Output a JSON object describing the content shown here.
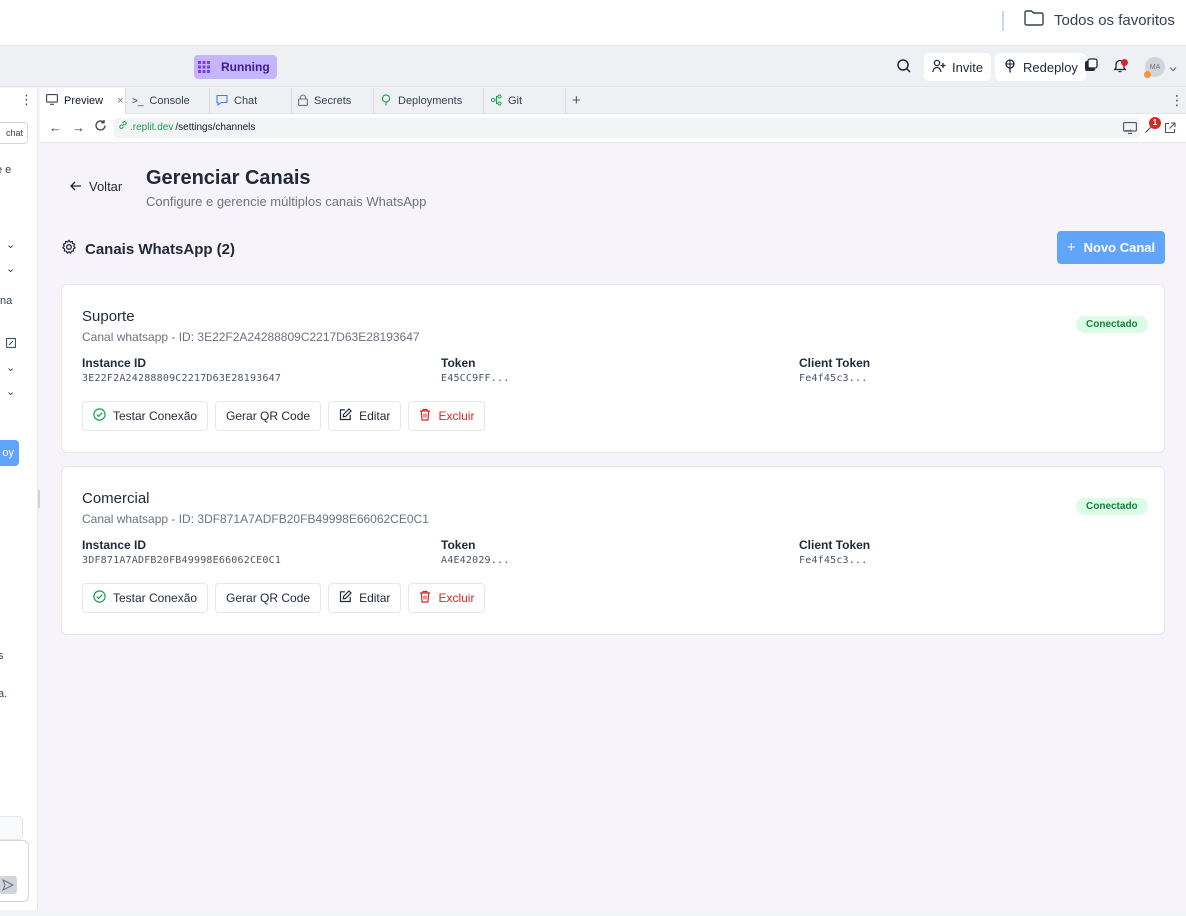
{
  "bookmarks": {
    "folder_label": "Todos os favoritos"
  },
  "topbar": {
    "status": "Running",
    "invite_label": "Invite",
    "redeploy_label": "Redeploy",
    "avatar_initials": "MA"
  },
  "left_pane": {
    "chat_button": "chat",
    "fragments": [
      "e e",
      "na",
      "s",
      "a."
    ],
    "deploy_fragment": "oy"
  },
  "tabs": [
    {
      "label": "Preview",
      "icon": "monitor-icon",
      "active": true
    },
    {
      "label": "Console",
      "icon": "terminal-icon"
    },
    {
      "label": "Chat",
      "icon": "chat-icon"
    },
    {
      "label": "Secrets",
      "icon": "lock-icon"
    },
    {
      "label": "Deployments",
      "icon": "deploy-icon"
    },
    {
      "label": "Git",
      "icon": "git-icon"
    }
  ],
  "urlbar": {
    "host": ".replit.dev",
    "path": "/settings/channels",
    "devtools_badge": "1"
  },
  "page": {
    "back_label": "Voltar",
    "title": "Gerenciar Canais",
    "subtitle": "Configure e gerencie múltiplos canais WhatsApp",
    "section_title": "Canais WhatsApp (2)",
    "new_button": "Novo Canal"
  },
  "field_labels": {
    "instance": "Instance ID",
    "token": "Token",
    "client_token": "Client Token"
  },
  "action_labels": {
    "test": "Testar Conexão",
    "qr": "Gerar QR Code",
    "edit": "Editar",
    "delete": "Excluir"
  },
  "channels": [
    {
      "name": "Suporte",
      "meta": "Canal whatsapp - ID: 3E22F2A24288809C2217D63E28193647",
      "status": "Conectado",
      "instance_id": "3E22F2A24288809C2217D63E28193647",
      "token": "E45CC9FF...",
      "client_token": "Fe4f45c3..."
    },
    {
      "name": "Comercial",
      "meta": "Canal whatsapp - ID: 3DF871A7ADFB20FB49998E66062CE0C1",
      "status": "Conectado",
      "instance_id": "3DF871A7ADFB20FB49998E66062CE0C1",
      "token": "A4E42029...",
      "client_token": "Fe4f45c3..."
    }
  ],
  "colors": {
    "accent": "#60a5fa",
    "running": "#c4b5fd",
    "success_bg": "#dcfce7",
    "success_text": "#15803d",
    "danger": "#dc2626"
  }
}
